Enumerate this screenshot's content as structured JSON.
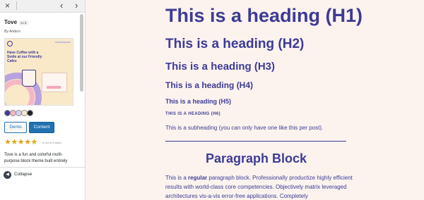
{
  "sidebar": {
    "close_icon": "×",
    "prev_icon": "‹",
    "next_icon": "›",
    "theme_name": "Tove",
    "version": "v1.5",
    "author": "By Anders",
    "screenshot": {
      "tagline": "Have Coffee with a Smile at our Friendly Cafes"
    },
    "swatches": [
      "#3d3b96",
      "#f4b6c4",
      "#d9d1ee",
      "#f9e9c9",
      "#1d2327"
    ],
    "demo_label": "Demo",
    "content_label": "Content",
    "stars": "★★★★★",
    "rating_count": "5 out of 5 stars",
    "description": "Tove is a fun and colorful multi-purpose block theme built entirely",
    "collapse_label": "Collapse",
    "collapse_icon": "◀"
  },
  "preview": {
    "h1": "This is a heading (H1)",
    "h2": "This is a heading (H2)",
    "h3": "This is a heading (H3)",
    "h4": "This is a heading (H4)",
    "h5": "This is a heading (H5)",
    "h6": "This is a heading (H6)",
    "subheading": "This is a subheading (you can only have one like this per post).",
    "paragraph_block_title": "Paragraph Block",
    "paragraph_before_bold": "This is a ",
    "paragraph_bold": "regular",
    "paragraph_after_bold": " paragraph block. Professionally productize highly efficient results with world-class core competencies. Objectively matrix leveraged architectures vis-a-vis error-free applications. Completely"
  },
  "colors": {
    "accent": "#3d3b96",
    "background": "#fcf3ee",
    "button_primary": "#2271b1",
    "stars": "#dba617"
  }
}
